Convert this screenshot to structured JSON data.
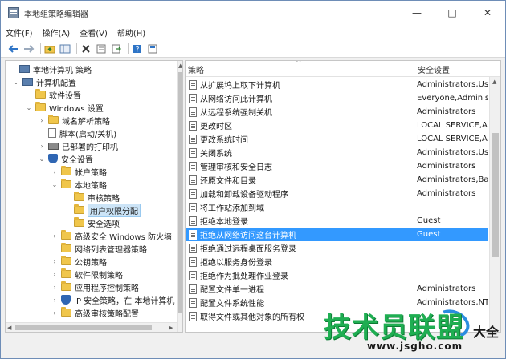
{
  "window": {
    "title": "本地组策略编辑器",
    "controls": {
      "minimize": "—",
      "maximize": "□",
      "close": "✕"
    }
  },
  "menu": [
    "文件(F)",
    "操作(A)",
    "查看(V)",
    "帮助(H)"
  ],
  "toolbar": {
    "buttons": [
      "back-arrow-icon",
      "forward-arrow-icon",
      "up-folder-icon",
      "show-hide-tree-icon",
      "delete-icon",
      "properties-icon",
      "export-icon",
      "help-icon",
      "view-icon"
    ]
  },
  "tree": {
    "items": [
      {
        "label": "本地计算机 策略",
        "icon": "computer-policy-icon",
        "expander": ""
      },
      {
        "label": "计算机配置",
        "icon": "computer-icon",
        "expander": "⌄"
      },
      {
        "label": "软件设置",
        "icon": "folder-icon",
        "expander": ""
      },
      {
        "label": "Windows 设置",
        "icon": "folder-icon",
        "expander": "⌄"
      },
      {
        "label": "域名解析策略",
        "icon": "folder-icon",
        "expander": "›"
      },
      {
        "label": "脚本(启动/关机)",
        "icon": "document-icon",
        "expander": ""
      },
      {
        "label": "已部署的打印机",
        "icon": "printer-icon",
        "expander": "›"
      },
      {
        "label": "安全设置",
        "icon": "shield-icon",
        "expander": "⌄"
      },
      {
        "label": "帐户策略",
        "icon": "folder-icon",
        "expander": "›"
      },
      {
        "label": "本地策略",
        "icon": "folder-icon",
        "expander": "⌄"
      },
      {
        "label": "审核策略",
        "icon": "folder-icon",
        "expander": ""
      },
      {
        "label": "用户权限分配",
        "icon": "folder-icon",
        "expander": ""
      },
      {
        "label": "安全选项",
        "icon": "folder-icon",
        "expander": ""
      },
      {
        "label": "高级安全 Windows 防火墙",
        "icon": "folder-icon",
        "expander": "›"
      },
      {
        "label": "网络列表管理器策略",
        "icon": "folder-icon",
        "expander": ""
      },
      {
        "label": "公钥策略",
        "icon": "folder-icon",
        "expander": "›"
      },
      {
        "label": "软件限制策略",
        "icon": "folder-icon",
        "expander": "›"
      },
      {
        "label": "应用程序控制策略",
        "icon": "folder-icon",
        "expander": "›"
      },
      {
        "label": "IP 安全策略，在 本地计算机",
        "icon": "shield-icon",
        "expander": "›"
      },
      {
        "label": "高级审核策略配置",
        "icon": "folder-icon",
        "expander": "›"
      }
    ],
    "selected": "用户权限分配"
  },
  "list": {
    "columns": [
      "策略",
      "安全设置"
    ],
    "sort_indicator": "^",
    "rows": [
      {
        "policy": "从扩展坞上取下计算机",
        "setting": "Administrators,Use"
      },
      {
        "policy": "从网络访问此计算机",
        "setting": "Everyone,Administ"
      },
      {
        "policy": "从远程系统强制关机",
        "setting": "Administrators"
      },
      {
        "policy": "更改时区",
        "setting": "LOCAL SERVICE,Ac"
      },
      {
        "policy": "更改系统时间",
        "setting": "LOCAL SERVICE,Ac"
      },
      {
        "policy": "关闭系统",
        "setting": "Administrators,Use"
      },
      {
        "policy": "管理审核和安全日志",
        "setting": "Administrators"
      },
      {
        "policy": "还原文件和目录",
        "setting": "Administrators,Bac"
      },
      {
        "policy": "加载和卸载设备驱动程序",
        "setting": "Administrators"
      },
      {
        "policy": "将工作站添加到域",
        "setting": ""
      },
      {
        "policy": "拒绝本地登录",
        "setting": "Guest"
      },
      {
        "policy": "拒绝从网络访问这台计算机",
        "setting": "Guest"
      },
      {
        "policy": "拒绝通过远程桌面服务登录",
        "setting": ""
      },
      {
        "policy": "拒绝以服务身份登录",
        "setting": ""
      },
      {
        "policy": "拒绝作为批处理作业登录",
        "setting": ""
      },
      {
        "policy": "配置文件单一进程",
        "setting": "Administrators"
      },
      {
        "policy": "配置文件系统性能",
        "setting": "Administrators,NT"
      },
      {
        "policy": "取得文件或其他对象的所有权",
        "setting": ""
      }
    ],
    "selected": "拒绝从网络访问这台计算机"
  },
  "watermark": {
    "text": "技术员联盟",
    "suffix": "大全",
    "url": "www.jsgho.com"
  },
  "colors": {
    "selection": "#3399ff",
    "tree_selection": "#cce4f7",
    "folder": "#f0c64b",
    "watermark_green": "#1fae52"
  }
}
